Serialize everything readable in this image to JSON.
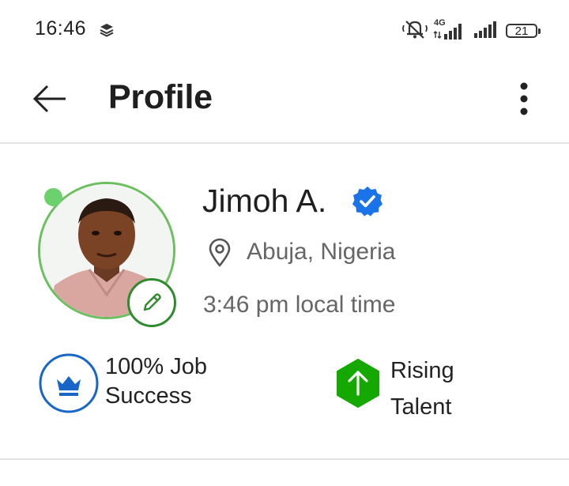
{
  "status_bar": {
    "time": "16:46",
    "network": "4G",
    "battery": "21",
    "icons": [
      "layers-icon",
      "mute-icon",
      "signal-4g-icon",
      "signal-icon",
      "battery-icon"
    ]
  },
  "header": {
    "title": "Profile",
    "back_icon": "arrow-left-icon",
    "menu_icon": "more-vertical-icon"
  },
  "profile": {
    "name": "Jimoh A.",
    "location": "Abuja, Nigeria",
    "local_time": "3:46 pm local time",
    "online": true,
    "verified": true
  },
  "badges": {
    "job_success_line1": "100% Job",
    "job_success_line2": "Success",
    "rising_line1": "Rising",
    "rising_line2": "Talent"
  },
  "colors": {
    "online": "#6bd16c",
    "ring": "#6cbf5e",
    "edit": "#2e8b2e",
    "verified": "#1a73e8",
    "job_success": "#1766c8",
    "rising_talent": "#14a800"
  }
}
